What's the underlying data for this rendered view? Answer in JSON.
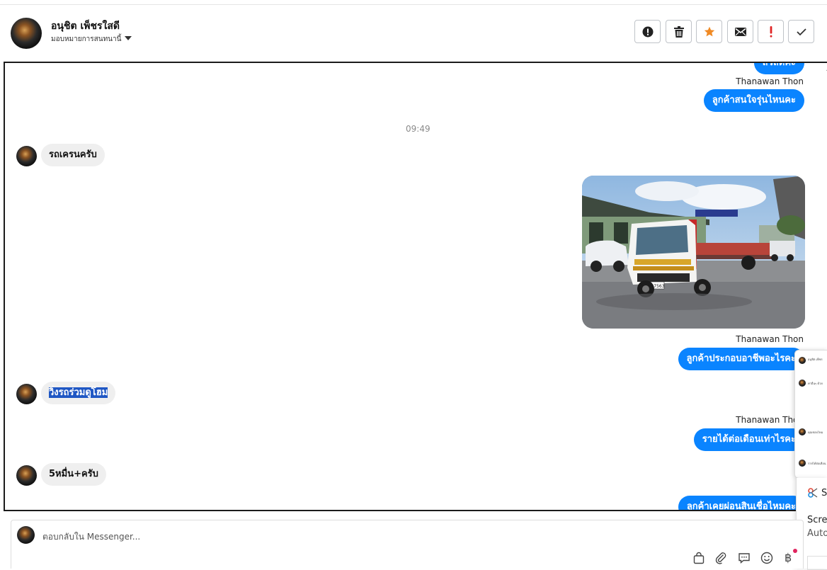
{
  "header": {
    "contact_name": "อนุชิต เพ็ชรใสดี",
    "assign_label": "มอบหมายการสนทนานี้",
    "actions": [
      "alert-icon",
      "trash-icon",
      "star-icon",
      "mail-icon",
      "exclamation-icon",
      "check-icon"
    ]
  },
  "colors": {
    "accent": "#0a84ff",
    "star": "#f08a24",
    "danger": "#e02424",
    "selection": "#1f57c4"
  },
  "messages": {
    "m0": "สวัสดีคะ",
    "s1": "Thanawan Thon",
    "m1": "ลูกค้าสนใจรุ่นไหนคะ",
    "time": "09:49",
    "m2": "รถเครนครับ",
    "s2": "Thanawan Thon",
    "m3": "ลูกค้าประกอบอาชีพอะไรคะ",
    "m4": "วิ่งรถร่วมดูโฮม",
    "s3": "Thanawan Thon",
    "m5": "รายได้ต่อเดือนเท่าไรคะ",
    "m6": "5หมื่น+ครับ",
    "m7": "ลูกค้าเคยผ่อนสินเชื่อไหมคะ"
  },
  "photo": {
    "plate": "87-7563"
  },
  "popup": {
    "t1": "อนุชิต เพ็ชร",
    "t2": "ค่าอื่นๆ ด้วย",
    "t3": "คุณชอบไหม",
    "t4": "รายได้ต่อเดือน"
  },
  "toast": {
    "title_fragment": "S",
    "line1": "Scree",
    "line2": "Auto"
  },
  "composer": {
    "placeholder": "ตอบกลับใน Messenger...",
    "baht": "฿"
  }
}
